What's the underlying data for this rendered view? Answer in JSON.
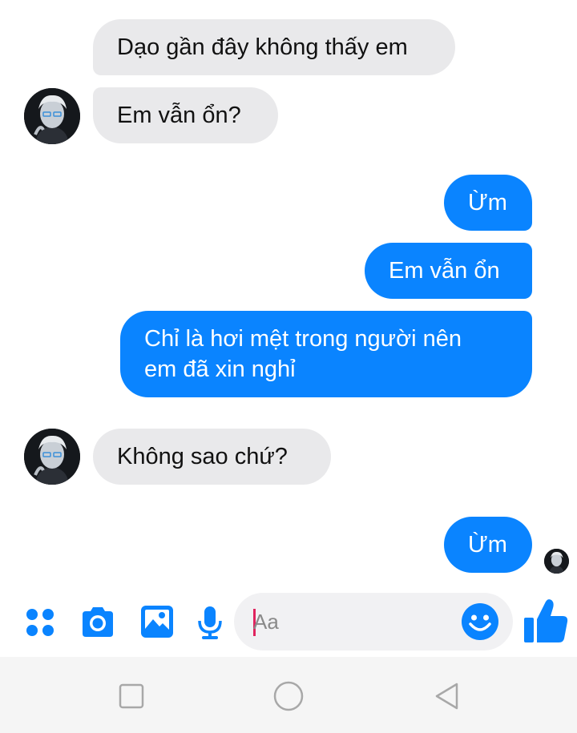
{
  "messages": [
    {
      "text": "Dạo gần đây không thấy em"
    },
    {
      "text": "Em vẫn ổn?"
    },
    {
      "text": "Ừm"
    },
    {
      "text": "Em vẫn ổn"
    },
    {
      "text": "Chỉ là hơi mệt trong người nên"
    },
    {
      "text": "em đã xin nghỉ"
    },
    {
      "text": "Không sao chứ?"
    },
    {
      "text": "Ừm"
    }
  ],
  "composer": {
    "placeholder": "Aa"
  },
  "colors": {
    "outgoing_bubble": "#0a84ff",
    "incoming_bubble": "#e9e9eb",
    "accent_icon": "#0a84ff",
    "caret": "#e0245e"
  },
  "icons": {
    "toolbar": [
      "more-dots-icon",
      "camera-icon",
      "gallery-icon",
      "microphone-icon"
    ],
    "composer": [
      "emoji-icon",
      "thumbs-up-icon"
    ],
    "navbar": [
      "recent-apps-icon",
      "home-icon",
      "back-icon"
    ]
  }
}
